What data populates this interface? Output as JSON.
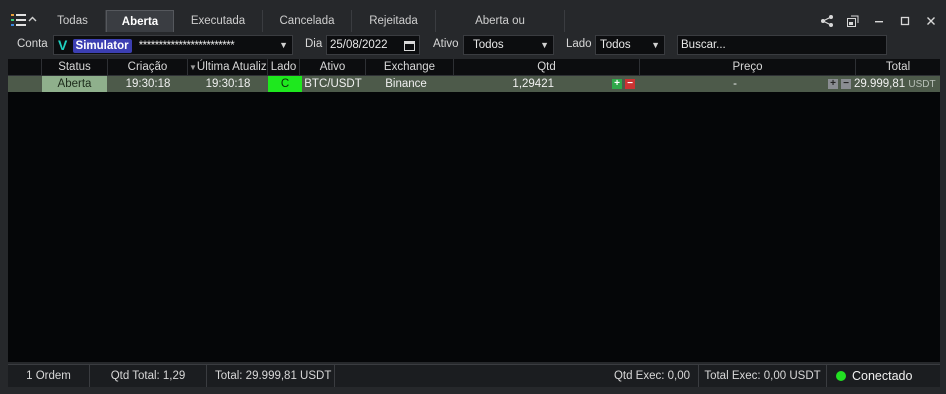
{
  "tabs": [
    {
      "label": "Todas",
      "active": false
    },
    {
      "label": "Aberta",
      "active": true
    },
    {
      "label": "Executada",
      "active": false
    },
    {
      "label": "Cancelada",
      "active": false
    },
    {
      "label": "Rejeitada",
      "active": false
    },
    {
      "label": "Aberta ou Executada",
      "active": false
    }
  ],
  "window_icons": [
    "share-icon",
    "popout-icon",
    "minimize-icon",
    "maximize-icon",
    "close-icon"
  ],
  "filters": {
    "conta_label": "Conta",
    "account_badge": "Simulator",
    "account_mask": "************************",
    "dia_label": "Dia",
    "dia_value": "25/08/2022",
    "ativo_label": "Ativo",
    "ativo_value": "Todos",
    "lado_label": "Lado",
    "lado_value": "Todos",
    "search_placeholder": "Buscar..."
  },
  "table": {
    "columns": [
      "Status",
      "Criação",
      "Última Atualização",
      "Lado",
      "Ativo",
      "Exchange",
      "Qtd",
      "Preço",
      "Total"
    ],
    "rows": [
      {
        "status": "Aberta",
        "criacao": "19:30:18",
        "ultima": "19:30:18",
        "lado": "C",
        "ativo": "BTC/USDT",
        "exchange": "Binance",
        "qtd": "1,29421",
        "preco": "-",
        "total": "29.999,81",
        "total_unit": "USDT"
      }
    ]
  },
  "status": {
    "ordens": "1 Ordem",
    "qtd_total": "Qtd Total: 1,29",
    "total": "Total: 29.999,81 USDT",
    "qtd_exec": "Qtd Exec: 0,00",
    "total_exec": "Total Exec: 0,00 USDT",
    "conexao": "Conectado"
  },
  "colors": {
    "connected": "#22e022",
    "buy": "#1ee81e",
    "status_open": "#8fb08c",
    "row_selected": "#4d5a4a"
  }
}
